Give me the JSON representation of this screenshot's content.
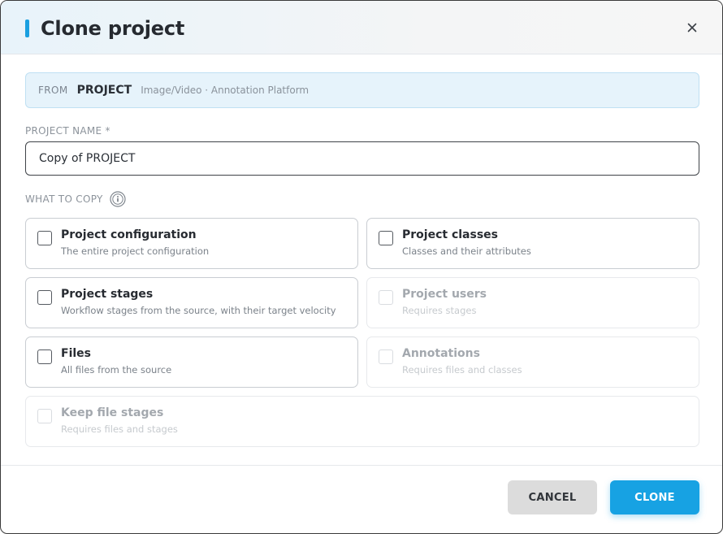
{
  "dialog": {
    "title": "Clone project",
    "accent_color": "#1a9fe0"
  },
  "from": {
    "label": "FROM",
    "project": "PROJECT",
    "meta": "Image/Video · Annotation Platform"
  },
  "project_name": {
    "label": "PROJECT NAME *",
    "value": "Copy of PROJECT"
  },
  "what_to_copy": {
    "label": "WHAT TO COPY",
    "options": [
      {
        "title": "Project configuration",
        "desc": "The entire project configuration",
        "checked": false,
        "enabled": true
      },
      {
        "title": "Project classes",
        "desc": "Classes and their attributes",
        "checked": false,
        "enabled": true
      },
      {
        "title": "Project stages",
        "desc": "Workflow stages from the source, with their target velocity",
        "checked": false,
        "enabled": true
      },
      {
        "title": "Project users",
        "desc": "Requires stages",
        "checked": false,
        "enabled": false
      },
      {
        "title": "Files",
        "desc": "All files from the source",
        "checked": false,
        "enabled": true
      },
      {
        "title": "Annotations",
        "desc": "Requires files and classes",
        "checked": false,
        "enabled": false
      },
      {
        "title": "Keep file stages",
        "desc": "Requires files and stages",
        "checked": false,
        "enabled": false
      }
    ]
  },
  "footer": {
    "cancel_label": "CANCEL",
    "clone_label": "CLONE",
    "primary_color": "#17a2e3"
  },
  "icons": {
    "close": "close-icon",
    "info": "info-icon"
  }
}
